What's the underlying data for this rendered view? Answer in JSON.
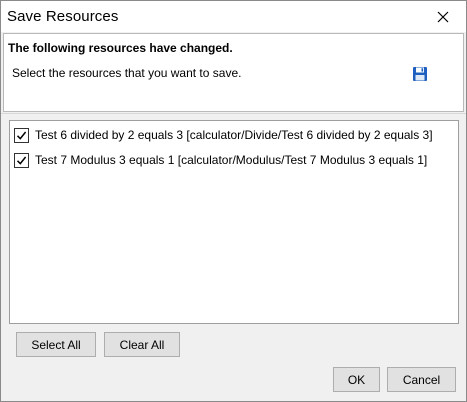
{
  "window": {
    "title": "Save Resources"
  },
  "header": {
    "title": "The following resources have changed.",
    "description": "Select the resources that you want to save."
  },
  "resources": [
    {
      "label": "Test 6 divided by  2 equals 3  [calculator/Divide/Test 6 divided by  2 equals 3]",
      "checked": true
    },
    {
      "label": "Test 7 Modulus 3 equals 1  [calculator/Modulus/Test 7 Modulus 3 equals 1]",
      "checked": true
    }
  ],
  "buttons": {
    "select_all": "Select All",
    "clear_all": "Clear All",
    "ok": "OK",
    "cancel": "Cancel"
  },
  "icons": {
    "close": "close-icon",
    "save": "save-icon",
    "checkmark": "checkmark-icon"
  },
  "colors": {
    "dialog_background": "#f0f0f0",
    "panel_background": "#ffffff",
    "button_background": "#e1e1e1",
    "save_icon_blue": "#1f5fbf"
  }
}
